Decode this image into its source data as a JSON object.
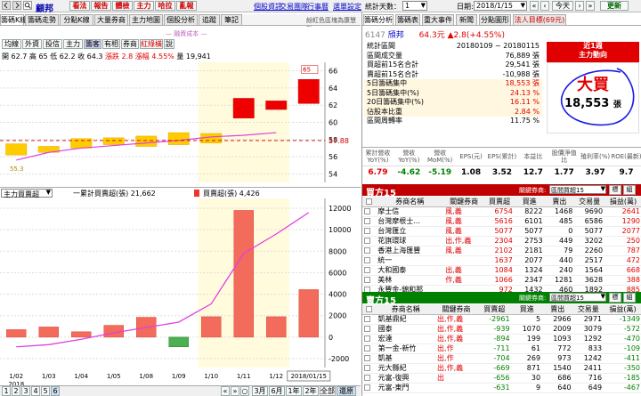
{
  "toolbar": {
    "left_tabs": [
      "籌碼K線",
      "籌碼走勢",
      "分點K線",
      "大量券商",
      "主力地圖",
      "個股分析",
      "追蹤",
      "筆記"
    ],
    "top_buttons": [
      "看法",
      "報告",
      "體檢",
      "主力",
      "哈拉",
      "亂報"
    ],
    "stock": "顧邦",
    "links": [
      "個股資訊",
      "交易團隊",
      "行事曆",
      "選單設定"
    ],
    "days_label": "統計天數：",
    "days_value": "1",
    "date_label": "日期:",
    "date_value": "2018/1/15",
    "today_btn": "今天",
    "update_btn": "更新",
    "slogan": "紛紅色區塊為康慧形"
  },
  "chart_tabs": [
    "均線",
    "外資",
    "投信",
    "主力",
    "籌客",
    "有相",
    "券商",
    "紅綠橫",
    "說"
  ],
  "ohlc": {
    "open": "開 62.7",
    "high": "高 65",
    "low": "低 62.2",
    "close": "收 64.3",
    "chg": "漲跌 2.8",
    "pct": "漲幅 4.55%",
    "vol": "量 19,941",
    "legend": "融資成本"
  },
  "price_chart": {
    "y_ticks": [
      "66",
      "64",
      "62",
      "60",
      "58",
      "56",
      "54"
    ],
    "current": "57.88",
    "first_label": "55.3",
    "top_label": "65"
  },
  "lower_chart": {
    "selector": "主力買賣超",
    "legend1": "一累計買賣超(張) 21,662",
    "legend2": "買賣超(張) 4,426",
    "y_ticks": [
      "12000",
      "10000",
      "8000",
      "6000",
      "4000",
      "2000",
      "0",
      "-2000"
    ],
    "x_ticks": [
      "1/02",
      "1/03",
      "1/04",
      "1/05",
      "1/08",
      "1/09",
      "1/10",
      "1/11",
      "1/12",
      "2018/01/15"
    ],
    "year": "2018",
    "pages": [
      "1",
      "2",
      "3",
      "4",
      "5",
      "6"
    ],
    "periods": [
      "3月",
      "6月",
      "1年",
      "2年",
      "全部",
      "還原"
    ]
  },
  "chart_data": [
    {
      "type": "bar",
      "title": "",
      "categories": [
        "1/02",
        "1/03",
        "1/04",
        "1/05",
        "1/08",
        "1/09",
        "1/10",
        "1/11",
        "1/12",
        "1/15"
      ],
      "ohlc": [
        [
          null,
          57.5,
          56.2,
          null
        ],
        [
          null,
          57.2,
          56.5,
          null
        ],
        [
          null,
          58.1,
          57.0,
          null
        ],
        [
          null,
          58.2,
          57.4,
          null
        ],
        [
          null,
          58.4,
          57.2,
          null
        ],
        [
          null,
          58.8,
          57.4,
          null
        ],
        [
          null,
          58.7,
          57.6,
          null
        ],
        [
          null,
          62.8,
          60.5,
          null
        ],
        [
          null,
          62.5,
          61.5,
          null
        ],
        [
          null,
          65.0,
          62.2,
          null
        ]
      ],
      "ma_line": [
        55.6,
        56.5,
        57.0,
        57.3,
        57.6,
        57.9,
        58.3,
        58.5,
        58.8,
        null
      ],
      "ylim": [
        53,
        67
      ]
    },
    {
      "type": "bar",
      "title": "",
      "categories": [
        "1/02",
        "1/03",
        "1/04",
        "1/05",
        "1/08",
        "1/09",
        "1/10",
        "1/11",
        "1/12",
        "1/15"
      ],
      "series": [
        {
          "name": "買賣超(張)",
          "values": [
            700,
            950,
            500,
            1100,
            1850,
            -900,
            1900,
            11800,
            1900,
            4426
          ]
        },
        {
          "name": "累計買賣超(張)",
          "values": [
            -900,
            -700,
            -200,
            400,
            900,
            1400,
            3100,
            7800,
            9600,
            11600
          ]
        }
      ],
      "ylim": [
        -2000,
        12500
      ]
    }
  ],
  "right": {
    "tabs": [
      "籌碼分析",
      "籌碼表",
      "重大事件",
      "新聞",
      "分點圖形",
      "法人目標(69元)"
    ],
    "stock_code": "6147",
    "stock_name": "頎邦",
    "price": "64.3元",
    "change": "▲2.8",
    "pct": "(+4.55%)",
    "stats": [
      {
        "label": "統計區間",
        "value": "20180109 ~ 20180115",
        "color": "#000"
      },
      {
        "label": "區間成交量",
        "value": "76,889 張",
        "color": "#000"
      },
      {
        "label": "買超前15名合計",
        "value": "29,541 張",
        "color": "#000"
      },
      {
        "label": "賣超前15名合計",
        "value": "-10,988 張",
        "color": "#000"
      },
      {
        "label": "5日籌碼集中",
        "value": "18,553 張",
        "color": "#e00000"
      },
      {
        "label": "5日籌碼集中(%)",
        "value": "24.13 %",
        "color": "#e00000"
      },
      {
        "label": "20日籌碼集中(%)",
        "value": "16.11 %",
        "color": "#e00000"
      },
      {
        "label": "佔股本比重",
        "value": "2.84 %",
        "color": "#e00000"
      },
      {
        "label": "區間周轉率",
        "value": "11.75 %",
        "color": "#000"
      }
    ],
    "badge_line1": "近1週",
    "badge_line2": "主力動向",
    "big": "大買",
    "big_value": "18,553",
    "big_unit": "張",
    "fin_headers": [
      "累計營收YoY(%)",
      "營收YoY(%)",
      "營收MoM(%)",
      "EPS(元)",
      "EPS(累計)",
      "本益比",
      "股價淨值比",
      "殖利率(%)",
      "ROE(最新)"
    ],
    "fin_values": [
      "6.79",
      "-4.62",
      "-5.19",
      "1.08",
      "3.52",
      "12.7",
      "1.77",
      "3.97",
      "9.7"
    ],
    "buy_title": "買方15",
    "sell_title": "賣方15",
    "agent_label": "關鍵券商:",
    "agent_value": "區間買超15",
    "hdr_mark": "標",
    "hdr_edit": "組",
    "cols": [
      "券商名稱",
      "關鍵券商",
      "買賣超",
      "買進",
      "賣出",
      "交易量",
      "損益(萬)"
    ],
    "buy_rows": [
      [
        "摩士信",
        "風,義",
        "6754",
        "8222",
        "1468",
        "9690",
        "2641"
      ],
      [
        "台灣摩根士...",
        "風,義",
        "5616",
        "6101",
        "485",
        "6586",
        "1290"
      ],
      [
        "台灣匯立",
        "風,義",
        "5077",
        "5077",
        "0",
        "5077",
        "2077"
      ],
      [
        "花旗環球",
        "出,作,義",
        "2304",
        "2753",
        "449",
        "3202",
        "250"
      ],
      [
        "香港上海匯豐",
        "風,義",
        "2102",
        "2181",
        "79",
        "2260",
        "787"
      ],
      [
        "統一",
        "",
        "1637",
        "2077",
        "440",
        "2517",
        "472"
      ],
      [
        "大和國泰",
        "出,義",
        "1084",
        "1324",
        "240",
        "1564",
        "668"
      ],
      [
        "美林",
        "作,義",
        "1066",
        "2347",
        "1281",
        "3628",
        "388"
      ],
      [
        "永豐金-錦和那",
        "",
        "972",
        "1432",
        "460",
        "1892",
        "885"
      ]
    ],
    "sell_rows": [
      [
        "凱基鼎紀",
        "出,作,義",
        "-2961",
        "5",
        "2966",
        "2971",
        "-1349"
      ],
      [
        "國泰",
        "出,作,義",
        "-939",
        "1070",
        "2009",
        "3079",
        "-572"
      ],
      [
        "宏達",
        "出,作,義",
        "-894",
        "199",
        "1093",
        "1292",
        "-470"
      ],
      [
        "第一金-新竹",
        "出,作",
        "-711",
        "61",
        "772",
        "833",
        "-109"
      ],
      [
        "凱基",
        "出,作",
        "-704",
        "269",
        "973",
        "1242",
        "-411"
      ],
      [
        "元大縣紀",
        "出,作,義",
        "-669",
        "871",
        "1540",
        "2411",
        "-350"
      ],
      [
        "元富-復興",
        "出",
        "-656",
        "30",
        "686",
        "716",
        "-185"
      ],
      [
        "元富-東門",
        "",
        "-631",
        "9",
        "640",
        "649",
        "-467"
      ]
    ]
  }
}
